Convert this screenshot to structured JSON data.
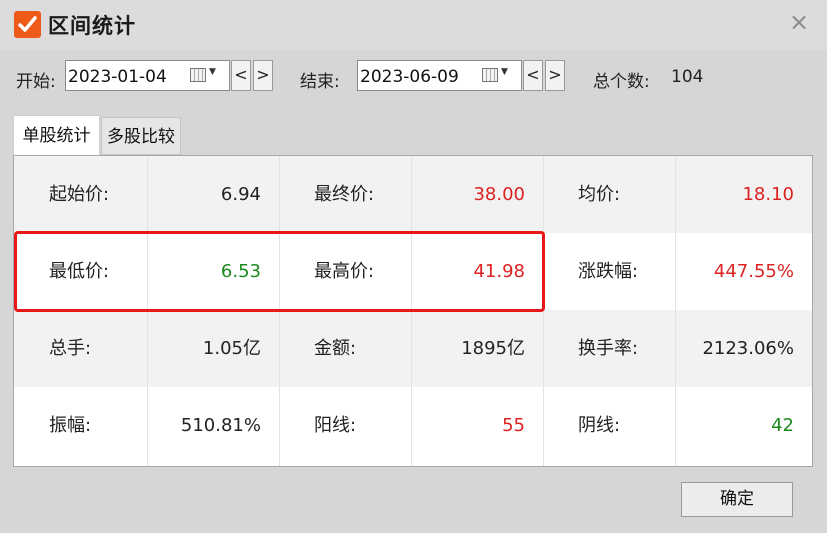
{
  "window": {
    "title": "区间统计",
    "close_icon": "×"
  },
  "date_range": {
    "start_label": "开始:",
    "start_value": "2023-01-04",
    "end_label": "结束:",
    "end_value": "2023-06-09",
    "prev": "<",
    "next": ">",
    "total_label": "总个数:",
    "total_value": "104"
  },
  "tabs": [
    {
      "label": "单股统计",
      "active": true
    },
    {
      "label": "多股比较",
      "active": false
    }
  ],
  "stats": [
    [
      {
        "label": "起始价:",
        "value": "6.94",
        "color": "black"
      },
      {
        "label": "最终价:",
        "value": "38.00",
        "color": "red"
      },
      {
        "label": "均价:",
        "value": "18.10",
        "color": "red"
      }
    ],
    [
      {
        "label": "最低价:",
        "value": "6.53",
        "color": "green"
      },
      {
        "label": "最高价:",
        "value": "41.98",
        "color": "red"
      },
      {
        "label": "涨跌幅:",
        "value": "447.55%",
        "color": "red"
      }
    ],
    [
      {
        "label": "总手:",
        "value": "1.05亿",
        "color": "black"
      },
      {
        "label": "金额:",
        "value": "1895亿",
        "color": "black"
      },
      {
        "label": "换手率:",
        "value": "2123.06%",
        "color": "black"
      }
    ],
    [
      {
        "label": "振幅:",
        "value": "510.81%",
        "color": "black"
      },
      {
        "label": "阳线:",
        "value": "55",
        "color": "red"
      },
      {
        "label": "阴线:",
        "value": "42",
        "color": "green"
      }
    ]
  ],
  "colors": {
    "red": "#dd2222",
    "green": "#1c8a1c",
    "accent": "#ee5a18",
    "highlight": "#e81818"
  },
  "ok_button": {
    "label": "确定"
  }
}
